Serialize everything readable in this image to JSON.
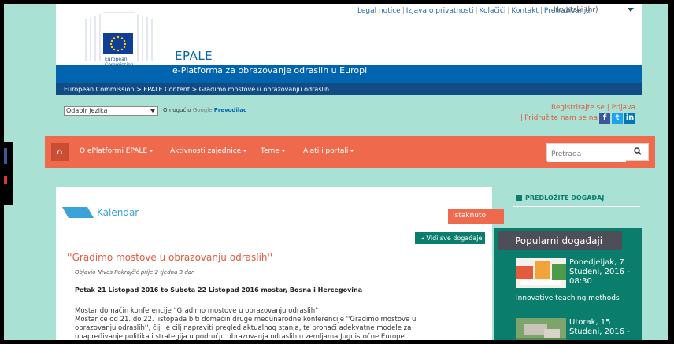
{
  "header": {
    "top_links": [
      "Legal notice",
      "Izjava o privatnosti",
      "Kolačići",
      "Kontakt",
      "Pretraživanje"
    ],
    "language": "Hrvatski (hr)",
    "ec_logo_text": [
      "European",
      "Commission"
    ],
    "title": "EPALE",
    "subtitle": "e-Platforma za obrazovanje odraslih u Europi",
    "breadcrumb": "European Commission > EPALE Content > Gradimo mostove u obrazovanju odraslih"
  },
  "translate": {
    "select_value": "Odabir jezika",
    "powered_prefix": "Omogućio",
    "powered_brand": "Google",
    "powered_suffix": "Prevodilac"
  },
  "account": {
    "register": "Registrirajte se",
    "login": "Prijava",
    "join_text": "Pridružite nam se na"
  },
  "nav": {
    "items": [
      "O ePlatformi EPALE",
      "Aktivnosti zajednice",
      "Teme",
      "Alati i portali"
    ],
    "search_placeholder": "Pretraga"
  },
  "main": {
    "section_title": "Kalendar",
    "featured_label": "Istaknuto",
    "view_all": "◂ Vidi sve događaje",
    "event_title": "''Gradimo mostove u obrazovanju odraslih''",
    "posted_by": "Objavio Nives Pokrajčić prije 2 tjedna 3 dan",
    "dates": "Petak 21 Listopad 2016 to Subota 22 Listopad 2016 mostar, Bosna i Hercegovina",
    "body_lines": [
      "Mostar domaćin konferencije \"Gradimo mostove u obrazovanju odraslih\"",
      "Mostar će od 21. do 22. listopada biti domaćin druge međunarodne konferencije ''Gradimo mostove u",
      "obrazovanju odraslih'', čiji je cilj napraviti pregled aktualnog stanja, te pronaći adekvatne modele za",
      "unapređivanje politika i strategija u području obrazovanja odraslih u zemljama Jugoistočne Europe."
    ]
  },
  "sidebar": {
    "propose_label": "PREDLOŽITE DOGAĐAJ",
    "popular_title": "Popularni događaji",
    "events": [
      {
        "date": "Ponedjeljak, 7 Studeni, 2016 - 08:30",
        "title": "Innovative teaching methods"
      },
      {
        "date": "Utorak, 15 Studeni, 2016 -",
        "title": ""
      }
    ]
  },
  "colors": {
    "page_bg": "#a9e1d5",
    "brand_blue": "#0064ae",
    "nav_orange": "#ef6a4c",
    "teal": "#0b7d6c",
    "calendar_blue": "#3aa3d8"
  }
}
